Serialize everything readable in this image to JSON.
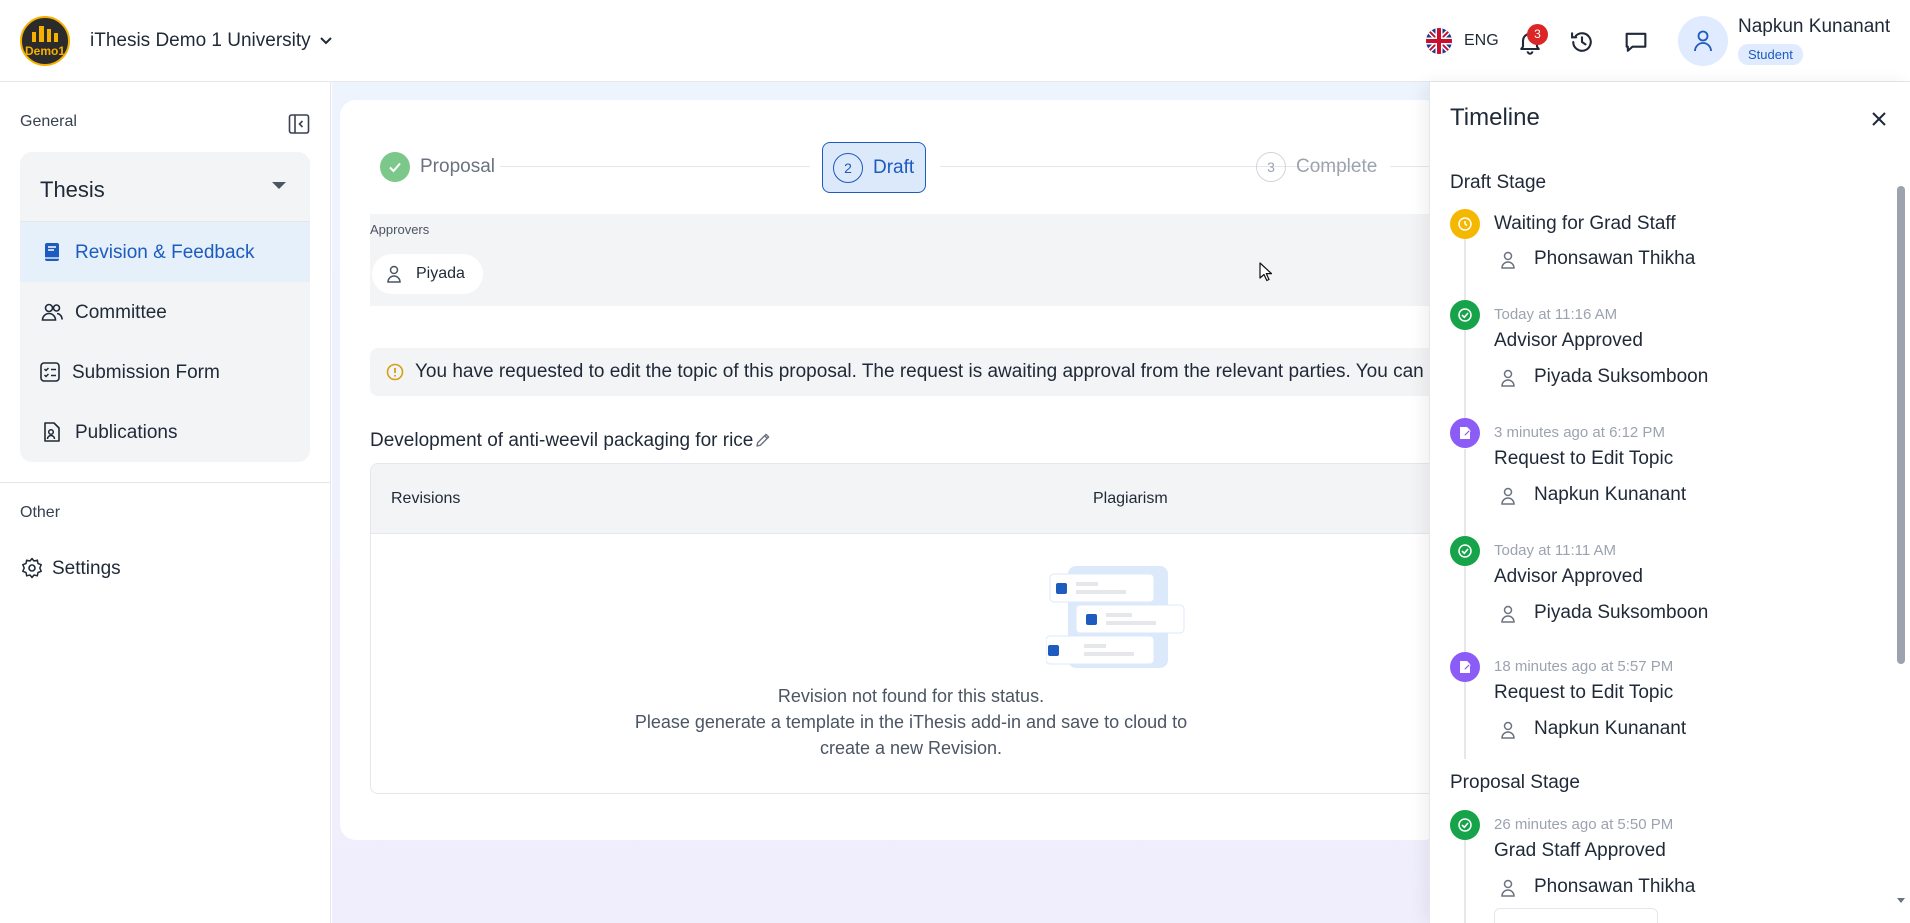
{
  "header": {
    "logo_text": "Demo1",
    "org_name": "iThesis Demo 1 University",
    "language": "ENG",
    "notification_count": "3",
    "user_name": "Napkun Kunanant",
    "user_role": "Student"
  },
  "sidebar": {
    "general_label": "General",
    "group_title": "Thesis",
    "items": [
      {
        "label": "Revision & Feedback",
        "icon": "book-icon",
        "active": true
      },
      {
        "label": "Committee",
        "icon": "people-icon"
      },
      {
        "label": "Submission Form",
        "icon": "checklist-icon"
      },
      {
        "label": "Publications",
        "icon": "document-person-icon"
      }
    ],
    "other_label": "Other",
    "settings_label": "Settings"
  },
  "main": {
    "steps": [
      {
        "label": "Proposal",
        "state": "done"
      },
      {
        "number": "2",
        "label": "Draft",
        "state": "active"
      },
      {
        "number": "3",
        "label": "Complete",
        "state": "pending"
      }
    ],
    "approvers_label": "Approvers",
    "approvers": [
      "Piyada"
    ],
    "alert_text": "You have requested to edit the topic of this proposal. The request is awaiting approval from the relevant parties. You can tra",
    "topic": "Development of anti-weevil packaging for rice",
    "table_headers": [
      "Revisions",
      "Plagiarism"
    ],
    "empty_lines": [
      "Revision not found for this status.",
      "Please generate a template in the iThesis add-in and save to cloud to",
      "create a new Revision."
    ]
  },
  "timeline": {
    "title": "Timeline",
    "draft_stage_label": "Draft Stage",
    "proposal_stage_label": "Proposal Stage",
    "events": [
      {
        "status": "Waiting for Grad Staff",
        "time": "",
        "person": "Phonsawan Thikha",
        "kind": "pending"
      },
      {
        "status": "Advisor Approved",
        "time": "Today at 11:16 AM",
        "person": "Piyada Suksomboon",
        "kind": "approved"
      },
      {
        "status": "Request to Edit Topic",
        "time": "3 minutes ago at 6:12 PM",
        "person": "Napkun Kunanant",
        "kind": "edit"
      },
      {
        "status": "Advisor Approved",
        "time": "Today at 11:11 AM",
        "person": "Piyada Suksomboon",
        "kind": "approved"
      },
      {
        "status": "Request to Edit Topic",
        "time": "18 minutes ago at 5:57 PM",
        "person": "Napkun Kunanant",
        "kind": "edit"
      },
      {
        "status": "Grad Staff Approved",
        "time": "26 minutes ago at 5:50 PM",
        "person": "Phonsawan Thikha",
        "kind": "approved"
      }
    ]
  },
  "colors": {
    "primary": "#1d5bbf",
    "approved": "#16a34a",
    "pending": "#f5b800",
    "edit": "#8b5cf6",
    "alert": "#d4a017"
  }
}
